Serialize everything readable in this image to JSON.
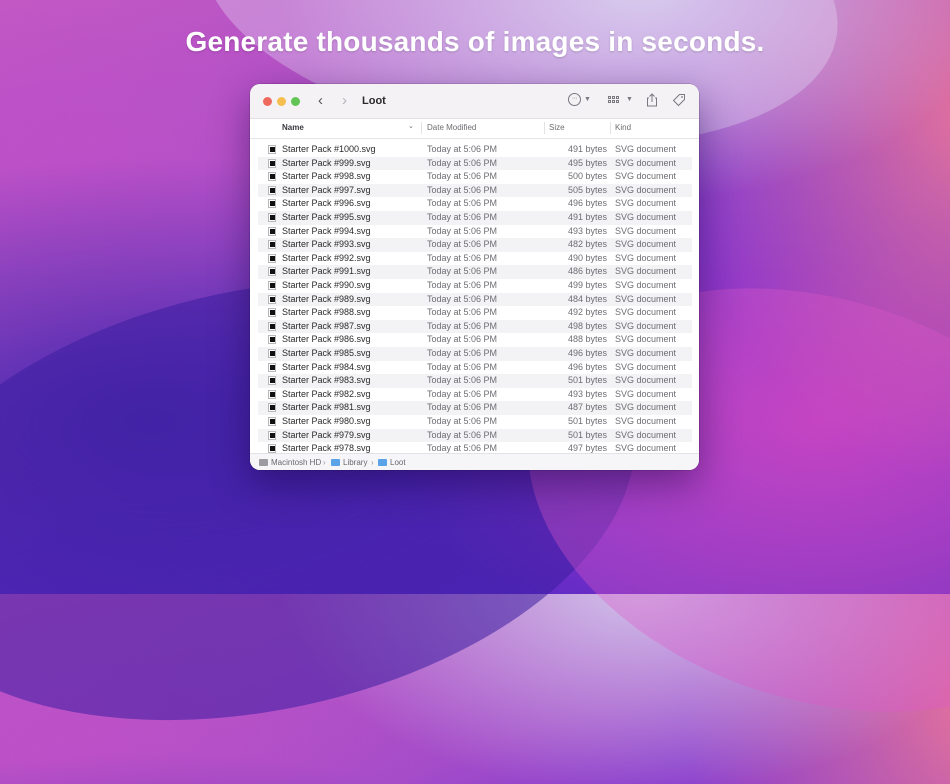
{
  "headline": "Generate thousands of images in seconds.",
  "window": {
    "title": "Loot",
    "toolbar": {
      "back_icon": "‹",
      "forward_icon": "›",
      "more_icon": "ellipsis-circle-icon",
      "view_icon": "grid-view-icon",
      "share_icon": "share-icon",
      "tag_icon": "tag-icon"
    },
    "columns": {
      "name": "Name",
      "date": "Date Modified",
      "size": "Size",
      "kind": "Kind"
    },
    "files": [
      {
        "name": "Starter Pack #1000.svg",
        "date": "Today at 5:06 PM",
        "size": "491 bytes",
        "kind": "SVG document"
      },
      {
        "name": "Starter Pack #999.svg",
        "date": "Today at 5:06 PM",
        "size": "495 bytes",
        "kind": "SVG document"
      },
      {
        "name": "Starter Pack #998.svg",
        "date": "Today at 5:06 PM",
        "size": "500 bytes",
        "kind": "SVG document"
      },
      {
        "name": "Starter Pack #997.svg",
        "date": "Today at 5:06 PM",
        "size": "505 bytes",
        "kind": "SVG document"
      },
      {
        "name": "Starter Pack #996.svg",
        "date": "Today at 5:06 PM",
        "size": "496 bytes",
        "kind": "SVG document"
      },
      {
        "name": "Starter Pack #995.svg",
        "date": "Today at 5:06 PM",
        "size": "491 bytes",
        "kind": "SVG document"
      },
      {
        "name": "Starter Pack #994.svg",
        "date": "Today at 5:06 PM",
        "size": "493 bytes",
        "kind": "SVG document"
      },
      {
        "name": "Starter Pack #993.svg",
        "date": "Today at 5:06 PM",
        "size": "482 bytes",
        "kind": "SVG document"
      },
      {
        "name": "Starter Pack #992.svg",
        "date": "Today at 5:06 PM",
        "size": "490 bytes",
        "kind": "SVG document"
      },
      {
        "name": "Starter Pack #991.svg",
        "date": "Today at 5:06 PM",
        "size": "486 bytes",
        "kind": "SVG document"
      },
      {
        "name": "Starter Pack #990.svg",
        "date": "Today at 5:06 PM",
        "size": "499 bytes",
        "kind": "SVG document"
      },
      {
        "name": "Starter Pack #989.svg",
        "date": "Today at 5:06 PM",
        "size": "484 bytes",
        "kind": "SVG document"
      },
      {
        "name": "Starter Pack #988.svg",
        "date": "Today at 5:06 PM",
        "size": "492 bytes",
        "kind": "SVG document"
      },
      {
        "name": "Starter Pack #987.svg",
        "date": "Today at 5:06 PM",
        "size": "498 bytes",
        "kind": "SVG document"
      },
      {
        "name": "Starter Pack #986.svg",
        "date": "Today at 5:06 PM",
        "size": "488 bytes",
        "kind": "SVG document"
      },
      {
        "name": "Starter Pack #985.svg",
        "date": "Today at 5:06 PM",
        "size": "496 bytes",
        "kind": "SVG document"
      },
      {
        "name": "Starter Pack #984.svg",
        "date": "Today at 5:06 PM",
        "size": "496 bytes",
        "kind": "SVG document"
      },
      {
        "name": "Starter Pack #983.svg",
        "date": "Today at 5:06 PM",
        "size": "501 bytes",
        "kind": "SVG document"
      },
      {
        "name": "Starter Pack #982.svg",
        "date": "Today at 5:06 PM",
        "size": "493 bytes",
        "kind": "SVG document"
      },
      {
        "name": "Starter Pack #981.svg",
        "date": "Today at 5:06 PM",
        "size": "487 bytes",
        "kind": "SVG document"
      },
      {
        "name": "Starter Pack #980.svg",
        "date": "Today at 5:06 PM",
        "size": "501 bytes",
        "kind": "SVG document"
      },
      {
        "name": "Starter Pack #979.svg",
        "date": "Today at 5:06 PM",
        "size": "501 bytes",
        "kind": "SVG document"
      },
      {
        "name": "Starter Pack #978.svg",
        "date": "Today at 5:06 PM",
        "size": "497 bytes",
        "kind": "SVG document"
      }
    ],
    "pathbar": {
      "items": [
        "Macintosh HD",
        "Library",
        "Loot"
      ],
      "separator": "›"
    }
  },
  "colors": {
    "close": "#ee6a5e",
    "minimize": "#f5be4f",
    "zoom": "#61c454",
    "folder": "#5aa3e8"
  }
}
